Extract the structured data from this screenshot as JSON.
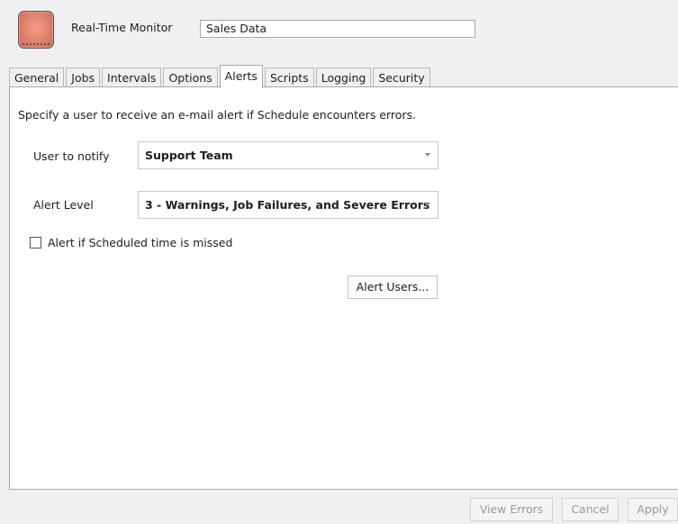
{
  "header": {
    "icon_name": "real-time-monitor-icon",
    "monitor_type": "Real-Time Monitor",
    "name_value": "Sales Data"
  },
  "tabs": [
    {
      "label": "General"
    },
    {
      "label": "Jobs"
    },
    {
      "label": "Intervals"
    },
    {
      "label": "Options"
    },
    {
      "label": "Alerts",
      "active": true
    },
    {
      "label": "Scripts"
    },
    {
      "label": "Logging"
    },
    {
      "label": "Security"
    }
  ],
  "alerts": {
    "instructions": "Specify a user to receive an e-mail alert if Schedule encounters errors.",
    "user_to_notify_label": "User to notify",
    "user_to_notify_value": "Support Team",
    "alert_level_label": "Alert Level",
    "alert_level_value": "3 - Warnings, Job Failures, and Severe Errors",
    "missed_time_checkbox_label": "Alert if Scheduled time is missed",
    "missed_time_checked": false,
    "alert_users_button": "Alert Users..."
  },
  "footer": {
    "view_errors_button": "View Errors",
    "cancel_button": "Cancel",
    "apply_button": "Apply"
  }
}
